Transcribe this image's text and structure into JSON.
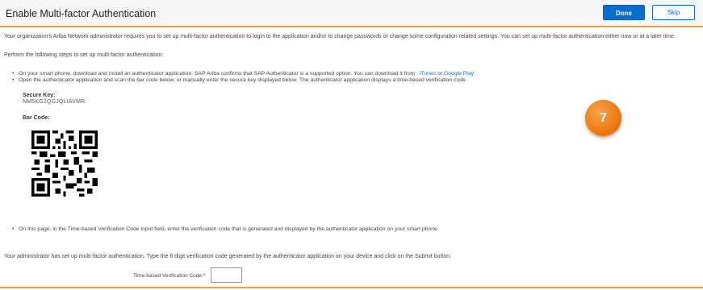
{
  "header": {
    "title": "Enable Multi-factor Authentication",
    "done_label": "Done",
    "skip_label": "Skip"
  },
  "intro": "Your organization's Ariba Network administrator requires you to set up multi-factor authentication to login to the application and/or to change passwords or change some configuration related settings. You can set up multi-factor authentication either now or at a later time.",
  "steps_heading": "Perform the following steps to set up multi-factor authentication:",
  "steps": {
    "step1_text": "On your smart phone, download and install an authenticator application. SAP Ariba confirms that SAP Authenticator is a supported option. You can download it from : ",
    "itunes_link": "iTunes",
    "or_text": " or ",
    "google_play_link": "Google Play",
    "step2_text": "Open the authenticator application and scan the bar code below, or manually enter the secure key displayed below. The authenticator application displays a time-based verification code.",
    "step3_text": "On this page, in the Time-based Verification Code input field, enter the verification code that is generated and displayed by the authenticator application on your smart phone."
  },
  "secure_key": {
    "label": "Secure Key:",
    "value": "NM5KG2QGJQLIAVMR"
  },
  "bar_code_label": "Bar Code:",
  "admin_text": "Your administrator has set up multi-factor authentication. Type the 6 digit verification code generated by the authenticator application on your device and click on the Submit button.",
  "verification": {
    "label": "Time-based Verification Code:*",
    "value": ""
  },
  "step_badge": "7",
  "colors": {
    "accent": "#f0a03c",
    "primary": "#0a6ed1",
    "badge": "#ef7d12"
  }
}
